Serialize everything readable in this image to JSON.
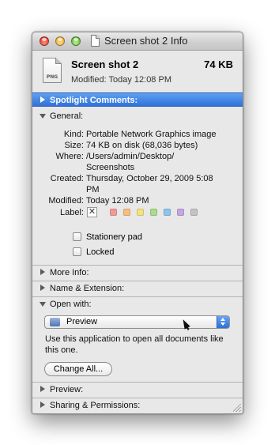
{
  "window": {
    "title": "Screen shot 2 Info",
    "buttons": [
      "close",
      "minimize",
      "zoom"
    ]
  },
  "header": {
    "icon_badge": "PNG",
    "name": "Screen shot 2",
    "size": "74 KB",
    "modified": "Modified: Today 12:08 PM"
  },
  "sections": {
    "spotlight": "Spotlight Comments:",
    "general": "General:",
    "more_info": "More Info:",
    "name_extension": "Name & Extension:",
    "open_with": "Open with:",
    "preview": "Preview:",
    "sharing": "Sharing & Permissions:"
  },
  "general": {
    "kind_key": "Kind:",
    "kind_val": "Portable Network Graphics image",
    "size_key": "Size:",
    "size_val": "74 KB on disk (68,036 bytes)",
    "where_key": "Where:",
    "where_val_1": "/Users/admin/Desktop/",
    "where_val_2": "Screenshots",
    "created_key": "Created:",
    "created_val_1": "Thursday, October 29, 2009 5:08",
    "created_val_2": "PM",
    "modified_key": "Modified:",
    "modified_val": "Today 12:08 PM",
    "label_key": "Label:",
    "label_none_glyph": "✕",
    "label_colors": [
      "#f29b95",
      "#f6bf7e",
      "#f4e37e",
      "#a9dc8b",
      "#8ec4ee",
      "#c6a5e5",
      "#c4c4c4"
    ],
    "stationery": "Stationery pad",
    "locked": "Locked"
  },
  "open_with": {
    "app": "Preview",
    "help": "Use this application to open all documents like this one.",
    "change_all": "Change All..."
  },
  "colors": {
    "spotlight_bg": "#2f72d9",
    "window_bg": "#e8e8e8"
  }
}
